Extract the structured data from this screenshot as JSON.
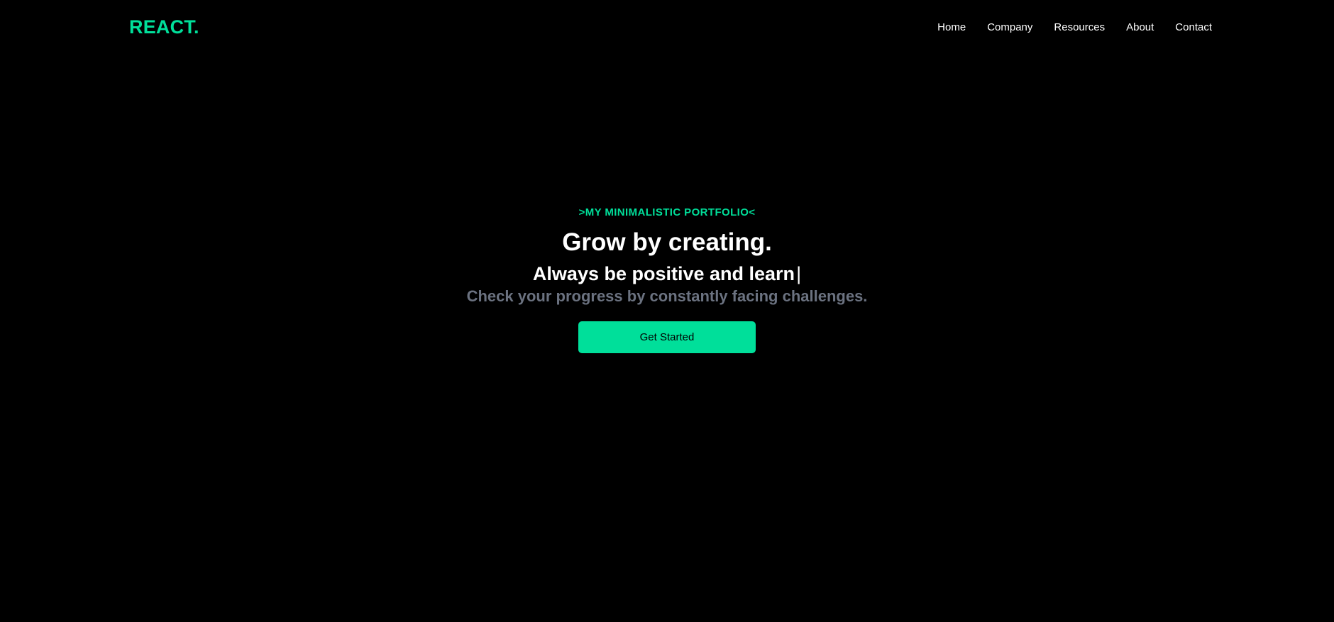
{
  "brand": {
    "logo_text": "REACT.",
    "accent_color": "#00df9a"
  },
  "nav": {
    "items": [
      {
        "label": "Home"
      },
      {
        "label": "Company"
      },
      {
        "label": "Resources"
      },
      {
        "label": "About"
      },
      {
        "label": "Contact"
      }
    ]
  },
  "hero": {
    "eyebrow": ">MY MINIMALISTIC PORTFOLIO<",
    "headline": "Grow by creating.",
    "typed_text": "Always be positive and learn",
    "typed_cursor": "|",
    "subline": "Check your progress by constantly facing challenges.",
    "cta_label": "Get Started"
  },
  "colors": {
    "background": "#000000",
    "text": "#ffffff",
    "muted_text": "#6b7280",
    "accent": "#00df9a"
  }
}
